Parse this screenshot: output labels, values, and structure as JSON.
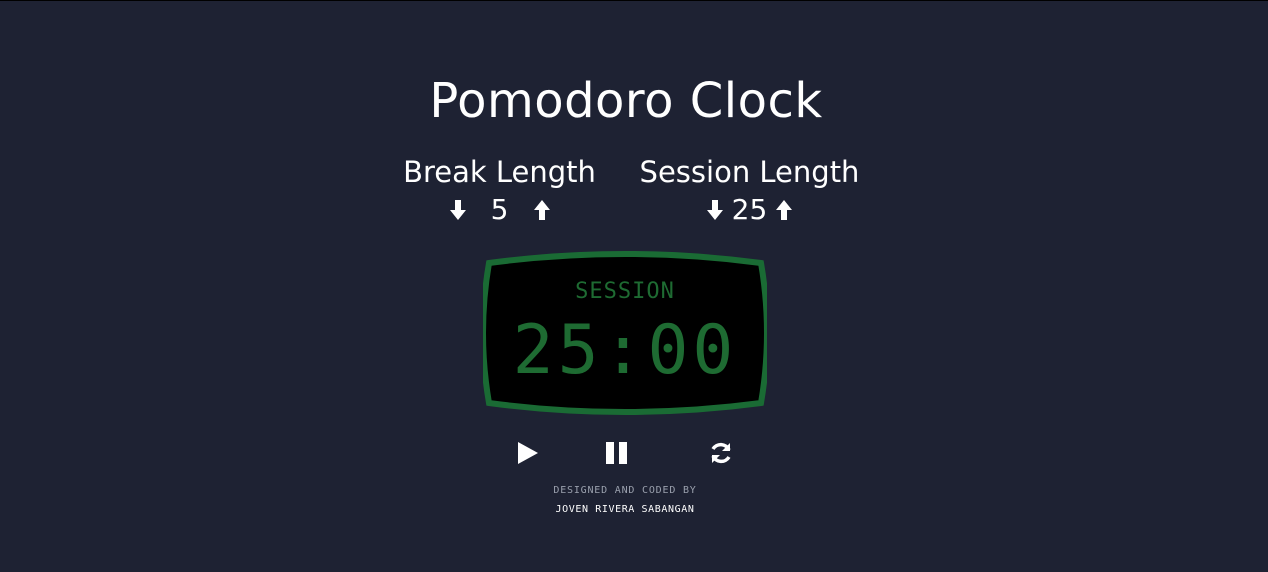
{
  "app": {
    "title": "Pomodoro Clock"
  },
  "break": {
    "label": "Break Length",
    "value": "5",
    "decrement_icon": "arrow-down-icon",
    "increment_icon": "arrow-up-icon"
  },
  "session": {
    "label": "Session Length",
    "value": "25",
    "decrement_icon": "arrow-down-icon",
    "increment_icon": "arrow-up-icon"
  },
  "timer": {
    "mode_label": "SESSION",
    "time": "25:00"
  },
  "transport": {
    "play_icon": "play-icon",
    "pause_icon": "pause-icon",
    "reset_icon": "refresh-icon"
  },
  "credit": {
    "line1": "DESIGNED AND CODED BY",
    "line2": "JOVEN RIVERA SABANGAN"
  },
  "colors": {
    "background": "#1e2233",
    "text": "#ffffff",
    "display_green": "#1e6b32",
    "display_bezel": "#1a6b34",
    "display_screen": "#000000"
  }
}
